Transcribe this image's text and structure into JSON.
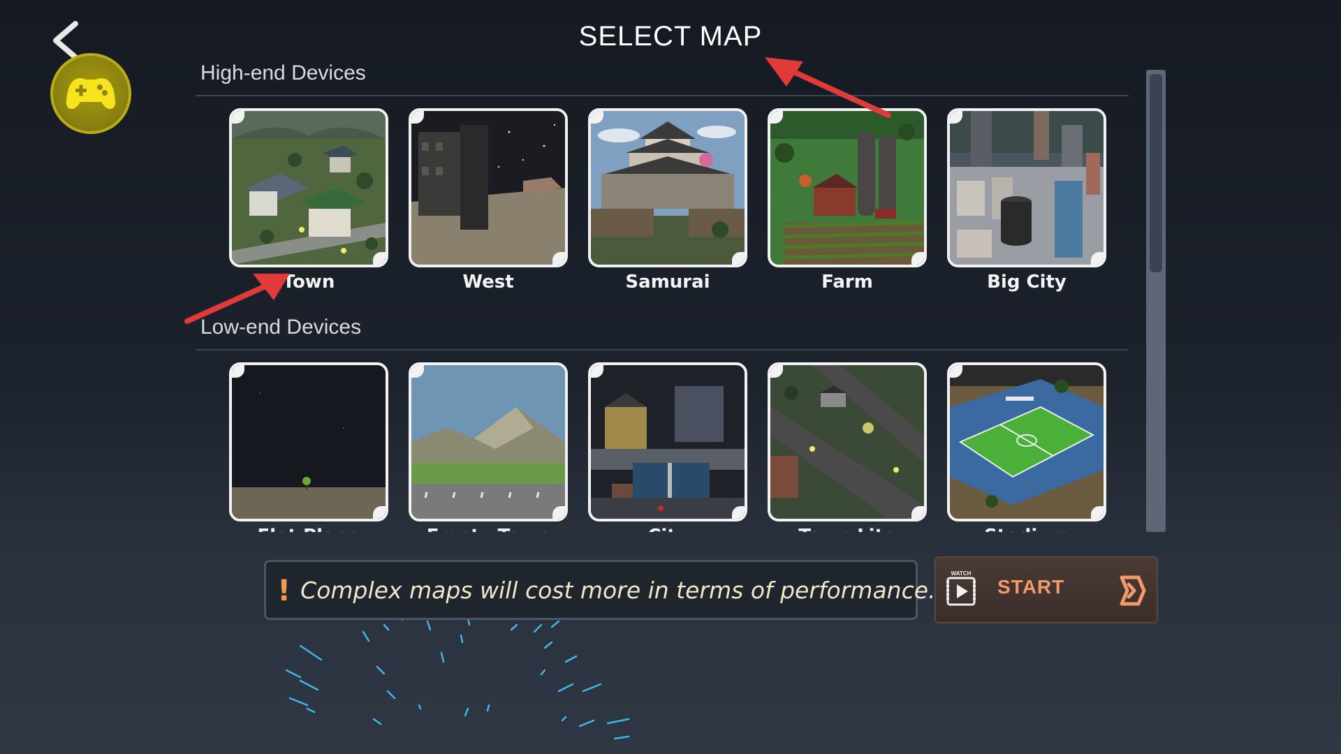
{
  "header": {
    "title": "SELECT MAP"
  },
  "sections": [
    {
      "title": "High-end Devices",
      "maps": [
        {
          "label": "Town"
        },
        {
          "label": "West"
        },
        {
          "label": "Samurai"
        },
        {
          "label": "Farm"
        },
        {
          "label": "Big City"
        }
      ]
    },
    {
      "title": "Low-end Devices",
      "maps": [
        {
          "label": "Flat Plane"
        },
        {
          "label": "Empty Town"
        },
        {
          "label": "City"
        },
        {
          "label": "Town Lite"
        },
        {
          "label": "Stadium"
        }
      ]
    }
  ],
  "notice": {
    "icon": "exclamation-icon",
    "text": "Complex maps will cost more in terms of performance."
  },
  "start_button": {
    "watch_label": "WATCH",
    "label": "START"
  },
  "colors": {
    "accent_orange": "#f29a6a",
    "gamepad_yellow": "#a39a10",
    "annotation_red": "#e03a3a"
  }
}
